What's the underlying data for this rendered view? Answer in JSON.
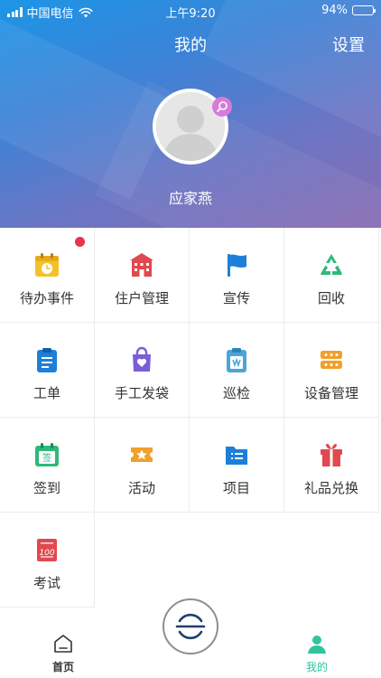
{
  "status_bar": {
    "carrier": "中国电信",
    "time": "上午9:20",
    "battery": "94%",
    "battery_level": 0.94
  },
  "nav": {
    "title": "我的",
    "settings_label": "设置"
  },
  "profile": {
    "name": "应家燕"
  },
  "menu": {
    "items": [
      {
        "label": "待办事件",
        "icon": "calendar-icon",
        "color": "#f5c12b",
        "badge": true
      },
      {
        "label": "住户管理",
        "icon": "building-icon",
        "color": "#e0494f"
      },
      {
        "label": "宣传",
        "icon": "flag-icon",
        "color": "#1d7fd8"
      },
      {
        "label": "回收",
        "icon": "recycle-icon",
        "color": "#2eb97a"
      },
      {
        "label": "工单",
        "icon": "clipboard-icon",
        "color": "#1d7fd8"
      },
      {
        "label": "手工发袋",
        "icon": "bag-icon",
        "color": "#7b5ed6"
      },
      {
        "label": "巡检",
        "icon": "inspection-clipboard-icon",
        "color": "#4aa6d6"
      },
      {
        "label": "设备管理",
        "icon": "device-icon",
        "color": "#f0a02b"
      },
      {
        "label": "签到",
        "icon": "sign-in-calendar-icon",
        "color": "#2eb97a"
      },
      {
        "label": "活动",
        "icon": "ticket-icon",
        "color": "#f0a02b"
      },
      {
        "label": "项目",
        "icon": "folder-icon",
        "color": "#1d7fd8"
      },
      {
        "label": "礼品兑换",
        "icon": "gift-icon",
        "color": "#e0494f"
      },
      {
        "label": "考试",
        "icon": "exam-icon",
        "color": "#e0494f"
      }
    ]
  },
  "tabbar": {
    "home_label": "首页",
    "mine_label": "我的",
    "active_color": "#2ec4a0",
    "scan_icon": "scan-icon"
  }
}
